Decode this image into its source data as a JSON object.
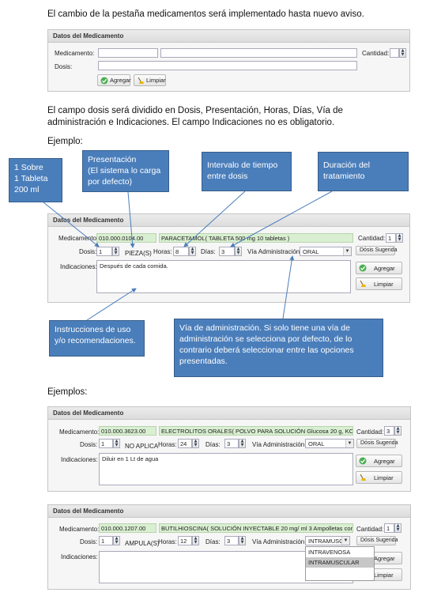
{
  "intro_text": "El cambio de la pestaña medicamentos será implementado hasta nuevo aviso.",
  "panel_title": "Datos del Medicamento",
  "labels": {
    "medicamento": "Medicamento:",
    "medicamento_cut": "Medicamento",
    "dosis": "Dosis:",
    "cantidad": "Cantidad:",
    "horas": "Horas:",
    "dias": "Días:",
    "via": "Vía Administración:",
    "indicaciones": "Indicaciones:"
  },
  "buttons": {
    "agregar": "Agregar",
    "limpiar": "Limpiar",
    "dosis_sugerida": "Dósis Sugerida"
  },
  "desc_text": "El campo dosis será dividido en Dosis, Presentación, Horas, Días, Vía de administración e Indicaciones. El campo Indicaciones no es obligatorio.",
  "ejemplo_label": "Ejemplo:",
  "ejemplos_label": "Ejemplos:",
  "callouts": {
    "dosis": [
      "1 Sobre",
      "1 Tableta",
      "200 ml"
    ],
    "presentacion": [
      "Presentación",
      "(El sistema lo carga",
      "por defecto)"
    ],
    "intervalo": [
      "Intervalo de tiempo",
      "entre dosis"
    ],
    "duracion": [
      "Duración del",
      "tratamiento"
    ],
    "instrucciones": [
      "Instrucciones de uso",
      "y/o recomendaciones."
    ],
    "via": [
      "Vía de administración. Si solo tiene una vía de",
      "administración se selecciona por defecto, de lo",
      "contrario deberá seleccionar entre las opciones",
      "presentadas."
    ]
  },
  "example1": {
    "code": "010.000.0104.00",
    "desc": "PARACETAMOL( TABLETA 500 mg 10 tabletas )",
    "cantidad": "1",
    "dosis": "1",
    "presentacion": "PIEZA(S)",
    "horas": "8",
    "dias": "3",
    "via": "ORAL",
    "indicaciones": "Después de cada comida."
  },
  "example2": {
    "code": "010.000.3623.00",
    "desc": "ELECTROLITOS ORALES( POLVO PARA SOLUCIÓN Glucosa 20 g, KCl 1.5 g,",
    "cantidad": "3",
    "dosis": "1",
    "presentacion": "NO APLICA",
    "horas": "24",
    "dias": "3",
    "via": "ORAL",
    "indicaciones": "Diluir en 1 Lt de agua"
  },
  "example3": {
    "code": "010.000.1207.00",
    "desc": "BUTILHIOSCINA( SOLUCIÓN INYECTABLE 20 mg/ ml 3 Ampolletas con 1.0",
    "cantidad": "1",
    "dosis": "1",
    "presentacion": "AMPULA(S)",
    "horas": "12",
    "dias": "3",
    "via": "INTRAMUSC",
    "options": [
      "INTRAVENOSA",
      "INTRAMUSCULAR"
    ]
  },
  "colors": {
    "callout": "#4a7ebb",
    "arrow": "#4a7ebb",
    "green_field": "#d9efd1"
  }
}
